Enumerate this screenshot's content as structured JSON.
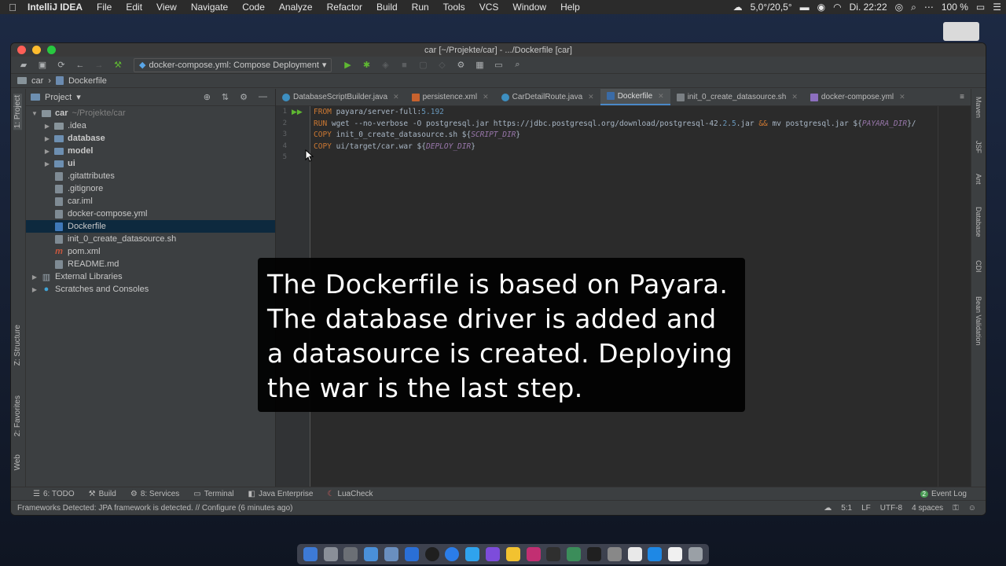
{
  "menubar": {
    "app": "IntelliJ IDEA",
    "items": [
      "File",
      "Edit",
      "View",
      "Navigate",
      "Code",
      "Analyze",
      "Refactor",
      "Build",
      "Run",
      "Tools",
      "VCS",
      "Window",
      "Help"
    ],
    "temperature": "5,0°/20,5°",
    "clock": "Di. 22:22",
    "battery": "100 %"
  },
  "window": {
    "title": "car [~/Projekte/car] - .../Dockerfile [car]"
  },
  "toolbar": {
    "run_config": "docker-compose.yml: Compose Deployment"
  },
  "navbar": {
    "crumbs": [
      "car",
      "Dockerfile"
    ]
  },
  "left_tabs": {
    "project": "1: Project",
    "structure": "Z: Structure",
    "favorites": "2: Favorites",
    "web": "Web"
  },
  "right_tabs": [
    "Maven",
    "JSF",
    "Ant",
    "Database",
    "CDI",
    "Bean Validation"
  ],
  "project_panel": {
    "title": "Project",
    "tree": [
      {
        "name": "car",
        "hint": "~/Projekte/car",
        "bold": true,
        "level": 0,
        "arrow": "down",
        "kind": "folder"
      },
      {
        "name": ".idea",
        "level": 1,
        "arrow": "right",
        "kind": "folder"
      },
      {
        "name": "database",
        "level": 1,
        "arrow": "right",
        "kind": "module",
        "bold": true
      },
      {
        "name": "model",
        "level": 1,
        "arrow": "right",
        "kind": "module",
        "bold": true
      },
      {
        "name": "ui",
        "level": 1,
        "arrow": "right",
        "kind": "module",
        "bold": true
      },
      {
        "name": ".gitattributes",
        "level": 1,
        "kind": "file"
      },
      {
        "name": ".gitignore",
        "level": 1,
        "kind": "file"
      },
      {
        "name": "car.iml",
        "level": 1,
        "kind": "file"
      },
      {
        "name": "docker-compose.yml",
        "level": 1,
        "kind": "file"
      },
      {
        "name": "Dockerfile",
        "level": 1,
        "kind": "file",
        "selected": true
      },
      {
        "name": "init_0_create_datasource.sh",
        "level": 1,
        "kind": "file"
      },
      {
        "name": "pom.xml",
        "level": 1,
        "kind": "maven"
      },
      {
        "name": "README.md",
        "level": 1,
        "kind": "file"
      },
      {
        "name": "External Libraries",
        "level": 0,
        "arrow": "right",
        "kind": "lib"
      },
      {
        "name": "Scratches and Consoles",
        "level": 0,
        "arrow": "right",
        "kind": "scratch"
      }
    ]
  },
  "editor_tabs": [
    {
      "label": "DatabaseScriptBuilder.java",
      "badge": "c"
    },
    {
      "label": "persistence.xml",
      "badge": "x"
    },
    {
      "label": "CarDetailRoute.java",
      "badge": "c"
    },
    {
      "label": "Dockerfile",
      "badge": "d",
      "active": true
    },
    {
      "label": "init_0_create_datasource.sh",
      "badge": "s"
    },
    {
      "label": "docker-compose.yml",
      "badge": "y"
    }
  ],
  "code": {
    "line_numbers": [
      "1",
      "2",
      "3",
      "4",
      "5"
    ],
    "lines": [
      [
        {
          "t": "FROM ",
          "c": "kw"
        },
        {
          "t": "payara/server-full:",
          "c": "str"
        },
        {
          "t": "5.192",
          "c": "num"
        }
      ],
      [
        {
          "t": "RUN ",
          "c": "kw"
        },
        {
          "t": "wget --no-verbose -O postgresql.jar https://jdbc.postgresql.org/download/postgresql-42.",
          "c": "str"
        },
        {
          "t": "2",
          "c": "num"
        },
        {
          "t": ".",
          "c": "str"
        },
        {
          "t": "5",
          "c": "num"
        },
        {
          "t": ".jar ",
          "c": "str"
        },
        {
          "t": "&& ",
          "c": "kw"
        },
        {
          "t": "mv postgresql.jar ${",
          "c": "str"
        },
        {
          "t": "PAYARA_DIR",
          "c": "var"
        },
        {
          "t": "}/",
          "c": "str"
        }
      ],
      [
        {
          "t": "COPY ",
          "c": "kw"
        },
        {
          "t": "init_0_create_datasource.sh ${",
          "c": "str"
        },
        {
          "t": "SCRIPT_DIR",
          "c": "var"
        },
        {
          "t": "}",
          "c": "str"
        }
      ],
      [
        {
          "t": "COPY ",
          "c": "kw"
        },
        {
          "t": "ui/target/car.war ${",
          "c": "str"
        },
        {
          "t": "DEPLOY_DIR",
          "c": "var"
        },
        {
          "t": "}",
          "c": "str"
        }
      ],
      []
    ]
  },
  "caption": {
    "lines": [
      "The Dockerfile is based on Payara.",
      "The database driver is added and",
      "a datasource is created. Deploying",
      "the war is the last step."
    ]
  },
  "tool_windows": [
    {
      "label": "6: TODO",
      "icon": "todo-icon"
    },
    {
      "label": "Build",
      "icon": "hammer-icon"
    },
    {
      "label": "8: Services",
      "icon": "services-icon"
    },
    {
      "label": "Terminal",
      "icon": "terminal-icon"
    },
    {
      "label": "Java Enterprise",
      "icon": "java-ee-icon"
    },
    {
      "label": "LuaCheck",
      "icon": "luacheck-icon"
    }
  ],
  "event_log": {
    "label": "Event Log",
    "count": "2"
  },
  "status": {
    "message": "Frameworks Detected: JPA framework is detected. // Configure (6 minutes ago)",
    "position": "5:1",
    "line_sep": "LF",
    "encoding": "UTF-8",
    "indent": "4 spaces"
  },
  "colors": {
    "selection": "#0d293e",
    "accent": "#4a88c7",
    "keyword": "#cc7832",
    "number": "#6897bb",
    "variable": "#9876aa"
  }
}
